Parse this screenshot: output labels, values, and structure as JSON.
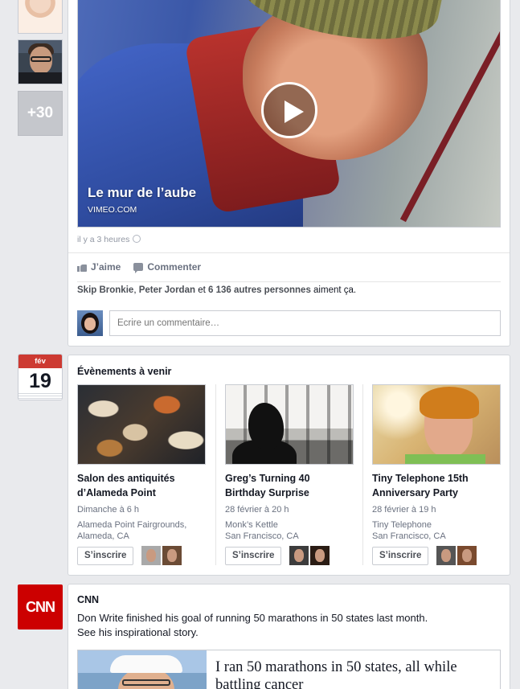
{
  "left_avatars": {
    "more_count": "+30"
  },
  "video_post": {
    "video_title": "Le mur de l’aube",
    "video_source": "VIMEO.COM",
    "timestamp": "il y a 3 heures",
    "actions": {
      "like": "J’aime",
      "comment": "Commenter"
    },
    "likes": {
      "name1": "Skip Bronkie",
      "sep1": ", ",
      "name2": "Peter Jordan",
      "sep2": " et ",
      "others": "6 136 autres personnes",
      "suffix": " aiment ça."
    },
    "comment_placeholder": "Écrire un commentaire…"
  },
  "calendar": {
    "month": "fév",
    "day": "19"
  },
  "events": {
    "title": "Évènements à venir",
    "button_label": "S’inscrire",
    "items": [
      {
        "name_line1": "Salon des antiquités",
        "name_line2": "d’Alameda Point",
        "when": "Dimanche à 6 h",
        "place": "Alameda Point Fairgrounds,",
        "city": "Alameda, CA"
      },
      {
        "name_line1": "Greg’s Turning 40",
        "name_line2": "Birthday Surprise",
        "when": "28 février à 20 h",
        "place": "Monk’s Kettle",
        "city": "San Francisco, CA"
      },
      {
        "name_line1": "Tiny Telephone 15th",
        "name_line2": "Anniversary Party",
        "when": "28 février à 19 h",
        "place": "Tiny Telephone",
        "city": "San Francisco, CA"
      }
    ]
  },
  "cnn_post": {
    "logo_text": "CNN",
    "name": "CNN",
    "text_line1": "Don Write finished his goal of running 50 marathons in 50 states last month.",
    "text_line2": "See his inspirational story.",
    "article_title": "I ran 50 marathons in 50 states, all while battling cancer"
  },
  "colors": {
    "page_bg": "#e9eaed",
    "calendar_red": "#cd3a32",
    "cnn_red": "#cc0000"
  }
}
